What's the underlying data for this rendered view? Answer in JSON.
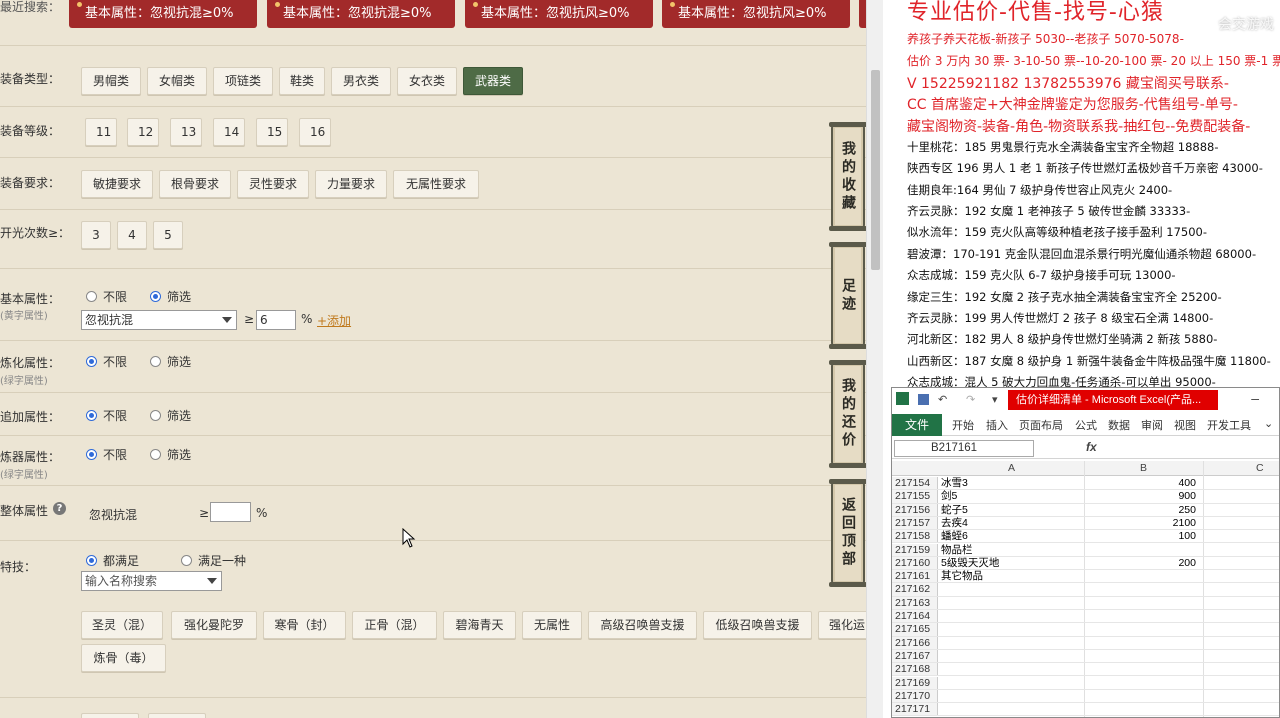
{
  "recent": {
    "label": "最近搜索：",
    "tags": [
      "基本属性：忽视抗混≥0%",
      "基本属性：忽视抗混≥0%",
      "基本属性：忽视抗风≥0%",
      "基本属性：忽视抗风≥0%"
    ]
  },
  "filters": {
    "equip_type": {
      "label": "装备类型：",
      "options": [
        "男帽类",
        "女帽类",
        "项链类",
        "鞋类",
        "男衣类",
        "女衣类",
        "武器类"
      ],
      "active": "武器类"
    },
    "equip_level": {
      "label": "装备等级：",
      "options": [
        "11",
        "12",
        "13",
        "14",
        "15",
        "16"
      ]
    },
    "equip_req": {
      "label": "装备要求：",
      "options": [
        "敏捷要求",
        "根骨要求",
        "灵性要求",
        "力量要求",
        "无属性要求"
      ]
    },
    "open_count": {
      "label": "开光次数≥：",
      "options": [
        "3",
        "4",
        "5"
      ]
    },
    "basic_attr": {
      "label": "基本属性：",
      "sub": "(黄字属性)",
      "radio_none": "不限",
      "radio_filter": "筛选",
      "select_value": "忽视抗混",
      "ge": "≥",
      "value": "6",
      "unit": "%",
      "add": "+添加"
    },
    "refine_attr": {
      "label": "炼化属性：",
      "sub": "(绿字属性)",
      "radio_none": "不限",
      "radio_filter": "筛选"
    },
    "extra_attr": {
      "label": "追加属性：",
      "radio_none": "不限",
      "radio_filter": "筛选"
    },
    "forge_attr": {
      "label": "炼器属性：",
      "sub": "(绿字属性)",
      "radio_none": "不限",
      "radio_filter": "筛选"
    },
    "overall_attr": {
      "label": "整体属性",
      "help": "?",
      "name": "忽视抗混",
      "ge": "≥",
      "unit": "%"
    },
    "skills": {
      "label": "特技：",
      "radio_all": "都满足",
      "radio_one": "满足一种",
      "search_placeholder": "输入名称搜索",
      "options": [
        "圣灵（混）",
        "强化曼陀罗",
        "寒骨（封）",
        "正骨（混）",
        "碧海青天",
        "无属性",
        "高级召唤兽支援",
        "低级召唤兽支援",
        "强化运",
        "炼骨（毒）"
      ]
    }
  },
  "side_tabs": [
    "我的收藏",
    "足迹",
    "我的还价",
    "返回顶部"
  ],
  "doc": {
    "title": "专业估价-代售-找号-心猿",
    "watermark": "会交游戏",
    "red_lines": [
      "养孩子养天花板-新孩子 5030--老孩子 5070-5078-",
      "估价 3 万内 30 票- 3-10-50 票--10-20-100 票- 20 以上 150 票-1 票 1 元-",
      "V 15225921182    13782553976    藏宝阁买号联系-",
      "CC 首席鉴定+大神金牌鉴定为您服务-代售组号-单号-",
      "藏宝阁物资-装备-角色-物资联系我-抽红包--免费配装备-"
    ],
    "lines": [
      "十里桃花：185 男鬼景行克水全满装备宝宝齐全物超 18888-",
      "陕西专区 196 男人 1 老 1 新孩子传世燃灯孟极妙音千万亲密 43000-",
      "佳期良年:164 男仙 7 级护身传世容止风克火 2400-",
      "齐云灵脉：192 女魔 1 老神孩子 5 破传世金麟 33333-",
      "似水流年：159 克火队高等级种植老孩子接手盈利 17500-",
      "碧波潭：170-191 克金队混回血混杀景行明光魔仙通杀物超 68000-",
      "众志成城：159 克火队 6-7 级护身接手可玩 13000-",
      "缘定三生：192 女魔 2 孩子克水抽全满装备宝宝齐全 25200-",
      "齐云灵脉：199 男人传世燃灯 2 孩子 8 级宝石全满 14800-",
      "河北新区：182 男人 8 级护身传世燃灯坐骑满 2 新孩 5880-",
      "山西新区：187 女魔 8 级护身 1 新强牛装备金牛阵极品强牛魔 11800-",
      "众志成城：混人 5 破大力回血鬼-任务通杀-可以单出 95000-"
    ]
  },
  "excel": {
    "title": "估价详细清单 - Microsoft Excel(产品...",
    "tabs": [
      "文件",
      "开始",
      "插入",
      "页面布局",
      "公式",
      "数据",
      "审阅",
      "视图",
      "开发工具"
    ],
    "namebox": "B217161",
    "fx": "fx",
    "columns": [
      "A",
      "B",
      "C"
    ],
    "rows": [
      {
        "n": "217154",
        "a": "冰雪3",
        "b": "400"
      },
      {
        "n": "217155",
        "a": "剑5",
        "b": "900"
      },
      {
        "n": "217156",
        "a": "蛇子5",
        "b": "250"
      },
      {
        "n": "217157",
        "a": "去疾4",
        "b": "2100"
      },
      {
        "n": "217158",
        "a": "蟠蛭6",
        "b": "100"
      },
      {
        "n": "217159",
        "a": "物品栏",
        "b": ""
      },
      {
        "n": "217160",
        "a": "5级毁天灭地",
        "b": "200"
      },
      {
        "n": "217161",
        "a": "其它物品",
        "b": ""
      },
      {
        "n": "217162",
        "a": "",
        "b": ""
      },
      {
        "n": "217163",
        "a": "",
        "b": ""
      },
      {
        "n": "217164",
        "a": "",
        "b": ""
      },
      {
        "n": "217165",
        "a": "",
        "b": ""
      },
      {
        "n": "217166",
        "a": "",
        "b": ""
      },
      {
        "n": "217167",
        "a": "",
        "b": ""
      },
      {
        "n": "217168",
        "a": "",
        "b": ""
      },
      {
        "n": "217169",
        "a": "",
        "b": ""
      },
      {
        "n": "217170",
        "a": "",
        "b": ""
      },
      {
        "n": "217171",
        "a": "",
        "b": ""
      }
    ]
  }
}
